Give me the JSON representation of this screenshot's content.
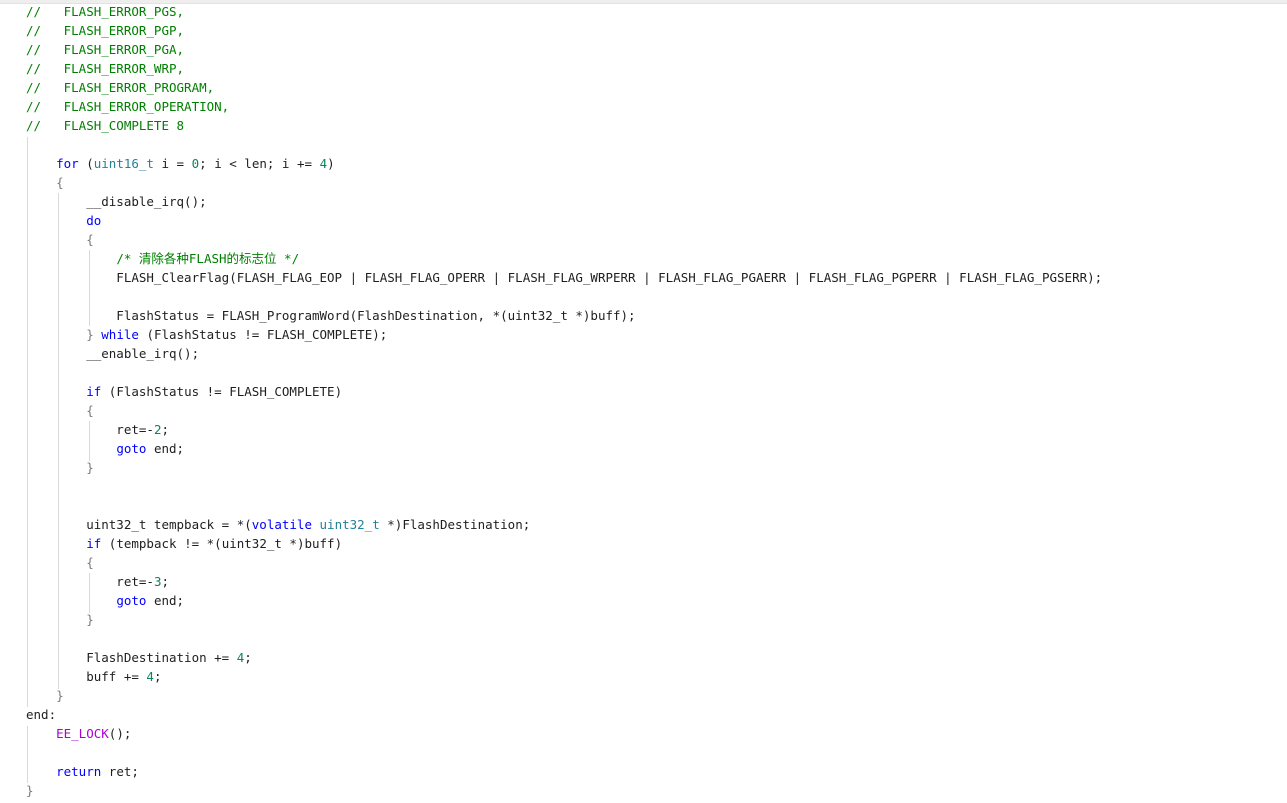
{
  "editor": {
    "lines": [
      {
        "segments": [
          {
            "cls": "comment",
            "text": "//   FLASH_ERROR_PGS,"
          }
        ]
      },
      {
        "segments": [
          {
            "cls": "comment",
            "text": "//   FLASH_ERROR_PGP,"
          }
        ]
      },
      {
        "segments": [
          {
            "cls": "comment",
            "text": "//   FLASH_ERROR_PGA,"
          }
        ]
      },
      {
        "segments": [
          {
            "cls": "comment",
            "text": "//   FLASH_ERROR_WRP,"
          }
        ]
      },
      {
        "segments": [
          {
            "cls": "comment",
            "text": "//   FLASH_ERROR_PROGRAM,"
          }
        ]
      },
      {
        "segments": [
          {
            "cls": "comment",
            "text": "//   FLASH_ERROR_OPERATION,"
          }
        ]
      },
      {
        "segments": [
          {
            "cls": "comment",
            "text": "//   FLASH_COMPLETE 8"
          }
        ]
      },
      {
        "segments": []
      },
      {
        "segments": [
          {
            "cls": "plain",
            "text": "    "
          },
          {
            "cls": "kw",
            "text": "for"
          },
          {
            "cls": "plain",
            "text": " ("
          },
          {
            "cls": "ty",
            "text": "uint16_t"
          },
          {
            "cls": "plain",
            "text": " i = "
          },
          {
            "cls": "num",
            "text": "0"
          },
          {
            "cls": "plain",
            "text": "; i < len; i += "
          },
          {
            "cls": "num",
            "text": "4"
          },
          {
            "cls": "plain",
            "text": ")"
          }
        ]
      },
      {
        "segments": [
          {
            "cls": "plain",
            "text": "    "
          },
          {
            "cls": "brace",
            "text": "{"
          }
        ]
      },
      {
        "segments": [
          {
            "cls": "plain",
            "text": "        __disable_irq();"
          }
        ]
      },
      {
        "segments": [
          {
            "cls": "plain",
            "text": "        "
          },
          {
            "cls": "kw",
            "text": "do"
          }
        ]
      },
      {
        "segments": [
          {
            "cls": "plain",
            "text": "        "
          },
          {
            "cls": "brace",
            "text": "{"
          }
        ]
      },
      {
        "segments": [
          {
            "cls": "plain",
            "text": "            "
          },
          {
            "cls": "comment",
            "text": "/* 清除各种FLASH的标志位 */"
          }
        ]
      },
      {
        "segments": [
          {
            "cls": "plain",
            "text": "            FLASH_ClearFlag(FLASH_FLAG_EOP | FLASH_FLAG_OPERR | FLASH_FLAG_WRPERR | FLASH_FLAG_PGAERR | FLASH_FLAG_PGPERR | FLASH_FLAG_PGSERR);"
          }
        ]
      },
      {
        "segments": []
      },
      {
        "segments": [
          {
            "cls": "plain",
            "text": "            FlashStatus = FLASH_ProgramWord(FlashDestination, *(uint32_t *)buff);"
          }
        ]
      },
      {
        "segments": [
          {
            "cls": "plain",
            "text": "        "
          },
          {
            "cls": "brace",
            "text": "}"
          },
          {
            "cls": "plain",
            "text": " "
          },
          {
            "cls": "kw",
            "text": "while"
          },
          {
            "cls": "plain",
            "text": " (FlashStatus != FLASH_COMPLETE);"
          }
        ]
      },
      {
        "segments": [
          {
            "cls": "plain",
            "text": "        __enable_irq();"
          }
        ]
      },
      {
        "segments": []
      },
      {
        "segments": [
          {
            "cls": "plain",
            "text": "        "
          },
          {
            "cls": "kw",
            "text": "if"
          },
          {
            "cls": "plain",
            "text": " (FlashStatus != FLASH_COMPLETE)"
          }
        ]
      },
      {
        "segments": [
          {
            "cls": "plain",
            "text": "        "
          },
          {
            "cls": "brace",
            "text": "{"
          }
        ]
      },
      {
        "segments": [
          {
            "cls": "plain",
            "text": "            ret=-"
          },
          {
            "cls": "num",
            "text": "2"
          },
          {
            "cls": "plain",
            "text": ";"
          }
        ]
      },
      {
        "segments": [
          {
            "cls": "plain",
            "text": "            "
          },
          {
            "cls": "kw",
            "text": "goto"
          },
          {
            "cls": "plain",
            "text": " end;"
          }
        ]
      },
      {
        "segments": [
          {
            "cls": "plain",
            "text": "        "
          },
          {
            "cls": "brace",
            "text": "}"
          }
        ]
      },
      {
        "segments": []
      },
      {
        "segments": []
      },
      {
        "segments": [
          {
            "cls": "plain",
            "text": "        uint32_t tempback = *("
          },
          {
            "cls": "kw",
            "text": "volatile"
          },
          {
            "cls": "plain",
            "text": " "
          },
          {
            "cls": "ty",
            "text": "uint32_t"
          },
          {
            "cls": "plain",
            "text": " *)FlashDestination;"
          }
        ]
      },
      {
        "segments": [
          {
            "cls": "plain",
            "text": "        "
          },
          {
            "cls": "kw",
            "text": "if"
          },
          {
            "cls": "plain",
            "text": " (tempback != *(uint32_t *)buff)"
          }
        ]
      },
      {
        "segments": [
          {
            "cls": "plain",
            "text": "        "
          },
          {
            "cls": "brace",
            "text": "{"
          }
        ]
      },
      {
        "segments": [
          {
            "cls": "plain",
            "text": "            ret=-"
          },
          {
            "cls": "num",
            "text": "3"
          },
          {
            "cls": "plain",
            "text": ";"
          }
        ]
      },
      {
        "segments": [
          {
            "cls": "plain",
            "text": "            "
          },
          {
            "cls": "kw",
            "text": "goto"
          },
          {
            "cls": "plain",
            "text": " end;"
          }
        ]
      },
      {
        "segments": [
          {
            "cls": "plain",
            "text": "        "
          },
          {
            "cls": "brace",
            "text": "}"
          }
        ]
      },
      {
        "segments": []
      },
      {
        "segments": [
          {
            "cls": "plain",
            "text": "        FlashDestination += "
          },
          {
            "cls": "num",
            "text": "4"
          },
          {
            "cls": "plain",
            "text": ";"
          }
        ]
      },
      {
        "segments": [
          {
            "cls": "plain",
            "text": "        buff += "
          },
          {
            "cls": "num",
            "text": "4"
          },
          {
            "cls": "plain",
            "text": ";"
          }
        ]
      },
      {
        "segments": [
          {
            "cls": "plain",
            "text": "    "
          },
          {
            "cls": "brace",
            "text": "}"
          }
        ]
      },
      {
        "segments": [
          {
            "cls": "plain",
            "text": "end:"
          }
        ]
      },
      {
        "segments": [
          {
            "cls": "plain",
            "text": "    "
          },
          {
            "cls": "macro",
            "text": "EE_LOCK"
          },
          {
            "cls": "plain",
            "text": "();"
          }
        ]
      },
      {
        "segments": []
      },
      {
        "segments": [
          {
            "cls": "plain",
            "text": "    "
          },
          {
            "cls": "kw",
            "text": "return"
          },
          {
            "cls": "plain",
            "text": " ret;"
          }
        ]
      },
      {
        "segments": [
          {
            "cls": "brace",
            "text": "}"
          }
        ]
      }
    ]
  },
  "colors": {
    "comment": "#008000",
    "keyword": "#0000ff",
    "type": "#267f99",
    "number": "#098658",
    "macro": "#af00db",
    "guide": "#d9d9d9"
  }
}
